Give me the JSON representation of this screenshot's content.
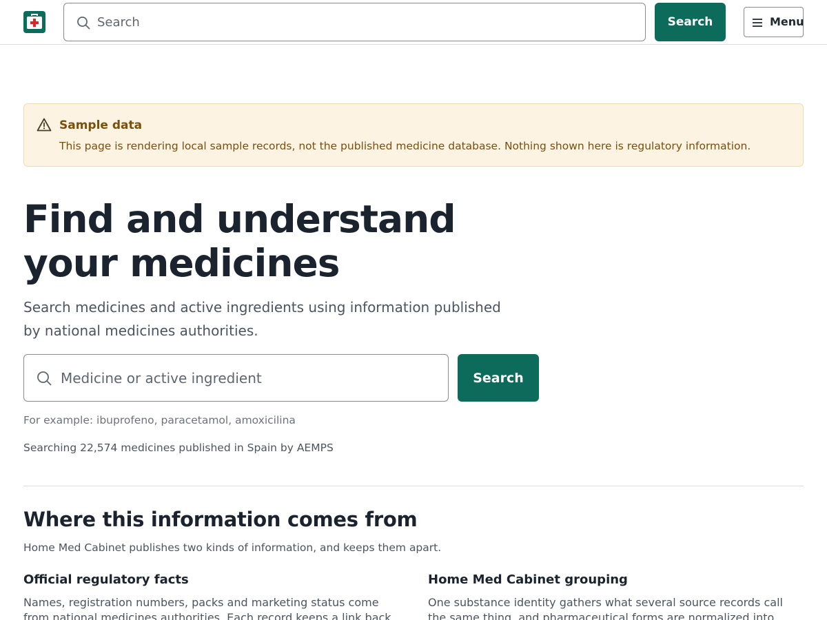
{
  "header": {
    "logo": "medicine-cabinet-logo",
    "search_placeholder": "Search",
    "search_button": "Search",
    "menu_label": "Menu"
  },
  "notice": {
    "title": "Sample data",
    "text": "This page is rendering local sample records, not the published medicine database. Nothing shown here is regulatory information."
  },
  "hero": {
    "title_line1": "Find and understand",
    "title_line2": "your medicines",
    "subtitle": "Search medicines and active ingredients using information published by national medicines authorities.",
    "search_placeholder": "Medicine or active ingredient",
    "search_button": "Search",
    "example": "For example: ibuprofeno, paracetamol, amoxicilina",
    "db_count": "Searching 22,574 medicines published in Spain by AEMPS"
  },
  "info": {
    "title": "Where this information comes from",
    "subtitle": "Home Med Cabinet publishes two kinds of information, and keeps them apart.",
    "columns": [
      {
        "title": "Official regulatory facts",
        "text": "Names, registration numbers, packs and marketing status come from national medicines authorities. Each record keeps a link back to the source."
      },
      {
        "title": "Home Med Cabinet grouping",
        "text": "One substance identity gathers what several source records call the same thing, and pharmaceutical forms are normalized into readable buckets."
      }
    ]
  },
  "colors": {
    "accent": "#0d6b5c",
    "notice_bg": "#fcf3e2",
    "notice_text": "#7a4f0c"
  }
}
